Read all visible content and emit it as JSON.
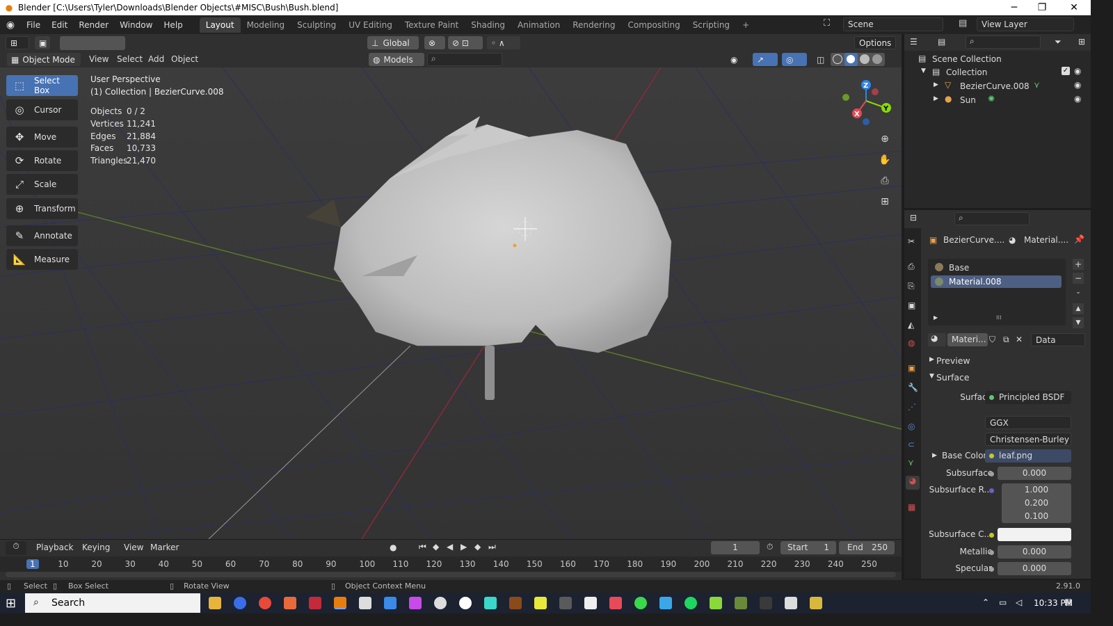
{
  "window": {
    "title": "Blender [C:\\Users\\Tyler\\Downloads\\Blender Objects\\#MISC\\Bush\\Bush.blend]",
    "minimize": "─",
    "maximize": "❐",
    "close": "✕"
  },
  "menu": {
    "items": [
      "File",
      "Edit",
      "Render",
      "Window",
      "Help"
    ],
    "workspaces": [
      "Layout",
      "Modeling",
      "Sculpting",
      "UV Editing",
      "Texture Paint",
      "Shading",
      "Animation",
      "Rendering",
      "Compositing",
      "Scripting"
    ],
    "add_tab": "+",
    "scene": "Scene",
    "view_layer": "View Layer"
  },
  "viewport_tools": {
    "orientation": "Global",
    "options": "Options"
  },
  "viewport_header": {
    "mode": "Object Mode",
    "menus": [
      "View",
      "Select",
      "Add",
      "Object"
    ],
    "collection_filter": "Models"
  },
  "toolbar": {
    "tools": [
      "Select Box",
      "Cursor",
      "Move",
      "Rotate",
      "Scale",
      "Transform",
      "Annotate",
      "Measure"
    ]
  },
  "overlay": {
    "perspective": "User Perspective",
    "context": "(1) Collection | BezierCurve.008",
    "stats": [
      {
        "label": "Objects",
        "value": "0 / 2"
      },
      {
        "label": "Vertices",
        "value": "11,241"
      },
      {
        "label": "Edges",
        "value": "21,884"
      },
      {
        "label": "Faces",
        "value": "10,733"
      },
      {
        "label": "Triangles",
        "value": "21,470"
      }
    ]
  },
  "gizmo": {
    "z": "Z",
    "y": "Y",
    "x": "X"
  },
  "outliner": {
    "root": "Scene Collection",
    "collection": "Collection",
    "objects": [
      "BezierCurve.008",
      "Sun"
    ]
  },
  "properties": {
    "object_name": "BezierCurve....",
    "material_name": "Material....",
    "slots": [
      "Base",
      "Material.008"
    ],
    "material_field": "Materi...",
    "link": "Data",
    "panels": {
      "preview": "Preview",
      "surface": "Surface"
    },
    "surface": {
      "surface_label": "Surface",
      "surface_value": "Principled BSDF",
      "distribution": "GGX",
      "subsurface_method": "Christensen-Burley",
      "base_color_label": "Base Color",
      "base_color_value": "leaf.png",
      "subsurface_label": "Subsurface",
      "subsurface_value": "0.000",
      "subsurface_radius_label": "Subsurface R...",
      "subsurface_radius": [
        "1.000",
        "0.200",
        "0.100"
      ],
      "subsurface_color_label": "Subsurface C...",
      "metallic_label": "Metallic",
      "metallic_value": "0.000",
      "specular_label": "Specular",
      "specular_value": "0.000"
    }
  },
  "timeline": {
    "menus": [
      "Playback",
      "Keying",
      "View",
      "Marker"
    ],
    "current_frame": "1",
    "start_label": "Start",
    "start": "1",
    "end_label": "End",
    "end": "250",
    "ticks": [
      "1",
      "10",
      "20",
      "30",
      "40",
      "50",
      "60",
      "70",
      "80",
      "90",
      "100",
      "110",
      "120",
      "130",
      "140",
      "150",
      "160",
      "170",
      "180",
      "190",
      "200",
      "210",
      "220",
      "230",
      "240",
      "250"
    ]
  },
  "statusbar": {
    "select": "Select",
    "box_select": "Box Select",
    "rotate_view": "Rotate View",
    "context_menu": "Object Context Menu",
    "version": "2.91.0"
  },
  "taskbar": {
    "search": "Search",
    "time": "10:33 PM"
  },
  "colors": {
    "accent": "#4772b3",
    "header": "#303030",
    "viewport_bg": "#3b3b3b",
    "axis_x": "#e24a55",
    "axis_y": "#8bdc00",
    "axis_z": "#2f83e8"
  }
}
